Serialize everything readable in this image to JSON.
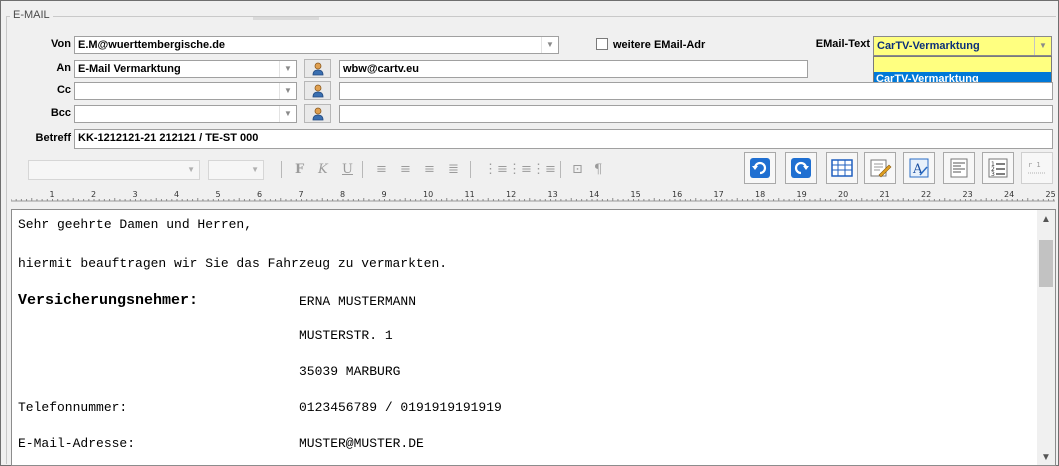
{
  "group": {
    "title": "E-MAIL"
  },
  "von": {
    "label": "Von",
    "value": "E.M@wuerttembergische.de"
  },
  "weitere": {
    "label": "weitere EMail-Adr"
  },
  "emailtext": {
    "label": "EMail-Text",
    "value": "CarTV-Vermarktung",
    "options": [
      "CarTV-Vermarktung"
    ]
  },
  "an": {
    "label": "An",
    "value": "E-Mail Vermarktung",
    "address": "wbw@cartv.eu"
  },
  "cc": {
    "label": "Cc",
    "value": "",
    "address": ""
  },
  "bcc": {
    "label": "Bcc",
    "value": "",
    "address": ""
  },
  "betreff": {
    "label": "Betreff",
    "value": "KK-1212121-21 212121 / TE-ST 000"
  },
  "toolbar": {
    "bold": "F",
    "italic": "K",
    "underline": "U",
    "para": "¶"
  },
  "ruler": {
    "numbers": [
      "1",
      "2",
      "3",
      "4",
      "5",
      "6",
      "7",
      "8",
      "9",
      "10",
      "11",
      "12",
      "13",
      "14",
      "15",
      "16",
      "17",
      "18",
      "19",
      "20",
      "21",
      "22",
      "23",
      "24",
      "25"
    ]
  },
  "body": {
    "greeting": "Sehr geehrte Damen und Herren,",
    "intro": "hiermit beauftragen wir Sie das Fahrzeug zu vermarkten.",
    "vn_label": "Versicherungsnehmer:",
    "vn_name": "ERNA MUSTERMANN",
    "vn_street": "MUSTERSTR. 1",
    "vn_city": "35039 MARBURG",
    "tel_label": "Telefonnummer:",
    "tel_value": "0123456789 / 0191919191919",
    "mail_label": "E-Mail-Adresse:",
    "mail_value": "MUSTER@MUSTER.DE"
  },
  "colors": {
    "highlight": "#ffff80",
    "selection": "#0078d7"
  }
}
